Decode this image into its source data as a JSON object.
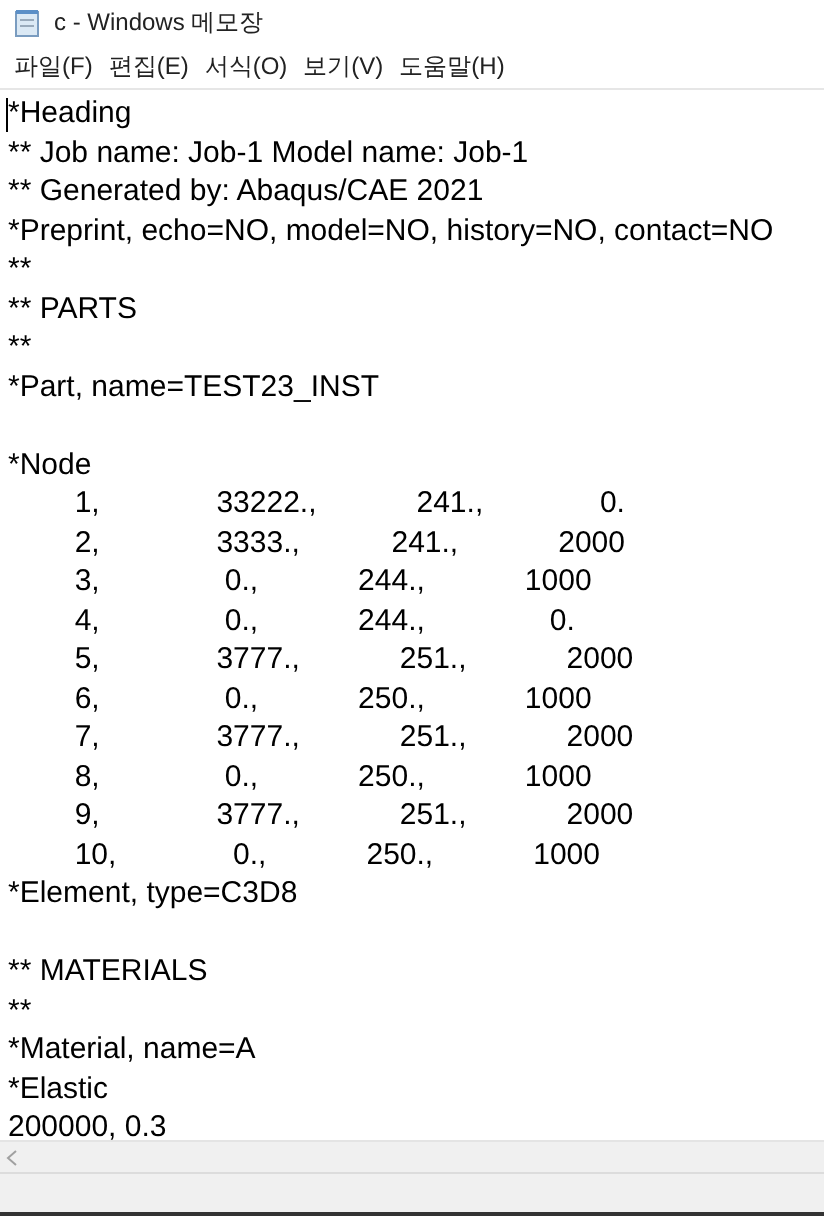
{
  "window": {
    "title": "c - Windows 메모장"
  },
  "menu": [
    "파일(F)",
    "편집(E)",
    "서식(O)",
    "보기(V)",
    "도움말(H)"
  ],
  "editor": {
    "lines": [
      "*Heading",
      "** Job name: Job-1 Model name: Job-1",
      "** Generated by: Abaqus/CAE 2021",
      "*Preprint, echo=NO, model=NO, history=NO, contact=NO",
      "**",
      "** PARTS",
      "**",
      "*Part, name=TEST23_INST",
      {
        "text": "*Node",
        "blank_before": true
      },
      "        1,              33222.,            241.,              0.",
      "        2,              3333.,           241.,            2000",
      "        3,               0.,            244.,            1000",
      "        4,               0.,            244.,               0.",
      "        5,              3777.,            251.,            2000",
      "        6,               0.,            250.,            1000",
      "        7,              3777.,            251.,            2000",
      "        8,               0.,            250.,            1000",
      "        9,              3777.,            251.,            2000",
      "        10,              0.,            250.,            1000",
      "*Element, type=C3D8",
      {
        "text": "** MATERIALS",
        "blank_before": true
      },
      "**",
      "*Material, name=A",
      "*Elastic",
      "200000, 0.3"
    ]
  }
}
